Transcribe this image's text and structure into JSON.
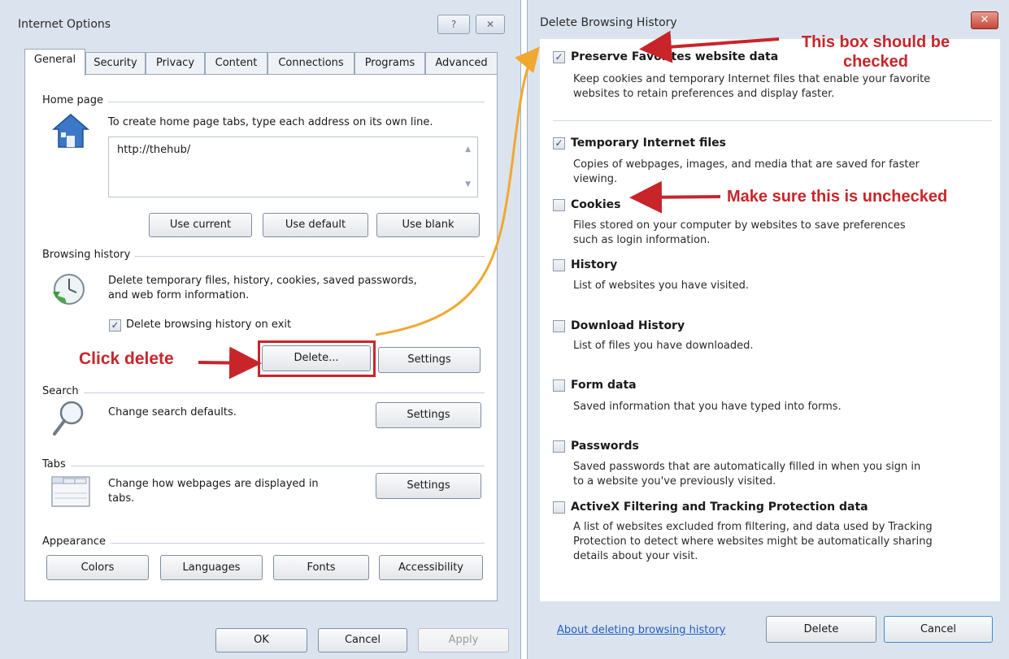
{
  "internet_options": {
    "title": "Internet Options",
    "help_btn": "?",
    "close_btn": "✕",
    "tabs": [
      "General",
      "Security",
      "Privacy",
      "Content",
      "Connections",
      "Programs",
      "Advanced"
    ],
    "home_page": {
      "label": "Home page",
      "desc": "To create home page tabs, type each address on its own line.",
      "url": "http://thehub/",
      "use_current": "Use current",
      "use_default": "Use default",
      "use_blank": "Use blank"
    },
    "browsing_history": {
      "label": "Browsing history",
      "desc_line1": "Delete temporary files, history, cookies, saved passwords,",
      "desc_line2": "and web form information.",
      "delete_on_exit": "Delete browsing history on exit",
      "delete_btn": "Delete...",
      "settings_btn": "Settings"
    },
    "search": {
      "label": "Search",
      "desc": "Change search defaults.",
      "settings_btn": "Settings"
    },
    "tabs_section": {
      "label": "Tabs",
      "desc_line1": "Change how webpages are displayed in",
      "desc_line2": "tabs.",
      "settings_btn": "Settings"
    },
    "appearance": {
      "label": "Appearance",
      "colors": "Colors",
      "languages": "Languages",
      "fonts": "Fonts",
      "accessibility": "Accessibility"
    },
    "footer": {
      "ok": "OK",
      "cancel": "Cancel",
      "apply": "Apply"
    }
  },
  "delete_history": {
    "title": "Delete Browsing History",
    "close_btn": "✕",
    "options": [
      {
        "title": "Preserve Favorites website data",
        "checked": true,
        "desc1": "Keep cookies and temporary Internet files that enable your favorite",
        "desc2": "websites to retain preferences and display faster."
      },
      {
        "title": "Temporary Internet files",
        "checked": true,
        "desc1": "Copies of webpages, images, and media that are saved for faster",
        "desc2": "viewing."
      },
      {
        "title": "Cookies",
        "checked": false,
        "desc1": "Files stored on your computer by websites to save preferences",
        "desc2": "such as login information."
      },
      {
        "title": "History",
        "checked": false,
        "desc1": "List of websites you have visited.",
        "desc2": ""
      },
      {
        "title": "Download History",
        "checked": false,
        "desc1": "List of files you have downloaded.",
        "desc2": ""
      },
      {
        "title": "Form data",
        "checked": false,
        "desc1": "Saved information that you have typed into forms.",
        "desc2": ""
      },
      {
        "title": "Passwords",
        "checked": false,
        "desc1": "Saved passwords that are automatically filled in when you sign in",
        "desc2": "to a website you've previously visited."
      },
      {
        "title": "ActiveX Filtering and Tracking Protection data",
        "checked": false,
        "desc1": "A list of websites excluded from filtering, and data used by Tracking",
        "desc2": "Protection to detect where websites might be automatically sharing",
        "desc3": "details about your visit."
      }
    ],
    "about_link": "About deleting browsing history",
    "delete_btn": "Delete",
    "cancel_btn": "Cancel"
  },
  "annotations": {
    "click_delete": "Click delete",
    "box_checked": "This box should be checked",
    "make_unchecked": "Make sure this is unchecked"
  },
  "colors": {
    "annotation_red": "#c8252a",
    "annotation_orange": "#f0a830",
    "dialog_bg": "#dbe4ee",
    "link_blue": "#1f5fbf"
  }
}
